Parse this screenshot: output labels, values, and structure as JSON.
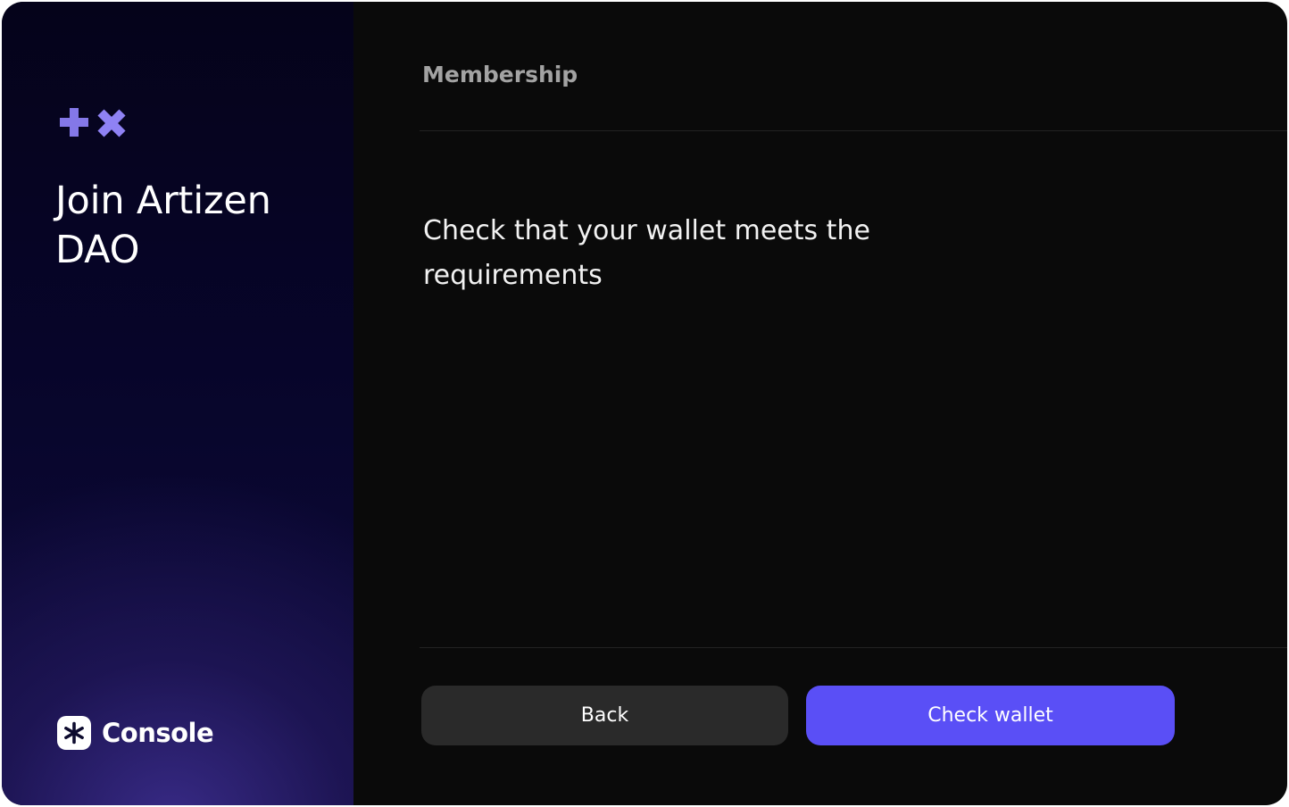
{
  "sidebar": {
    "title": "Join Artizen DAO",
    "brand_icon": "plus-cross-logo",
    "footer_logo_name": "Console",
    "footer_logo_icon": "asterisk-icon",
    "accent_color": "#8b7df0"
  },
  "main": {
    "section_title": "Membership",
    "description": "Check that your wallet meets the requirements"
  },
  "actions": {
    "back_label": "Back",
    "primary_label": "Check wallet",
    "primary_color": "#5a4ff6"
  }
}
